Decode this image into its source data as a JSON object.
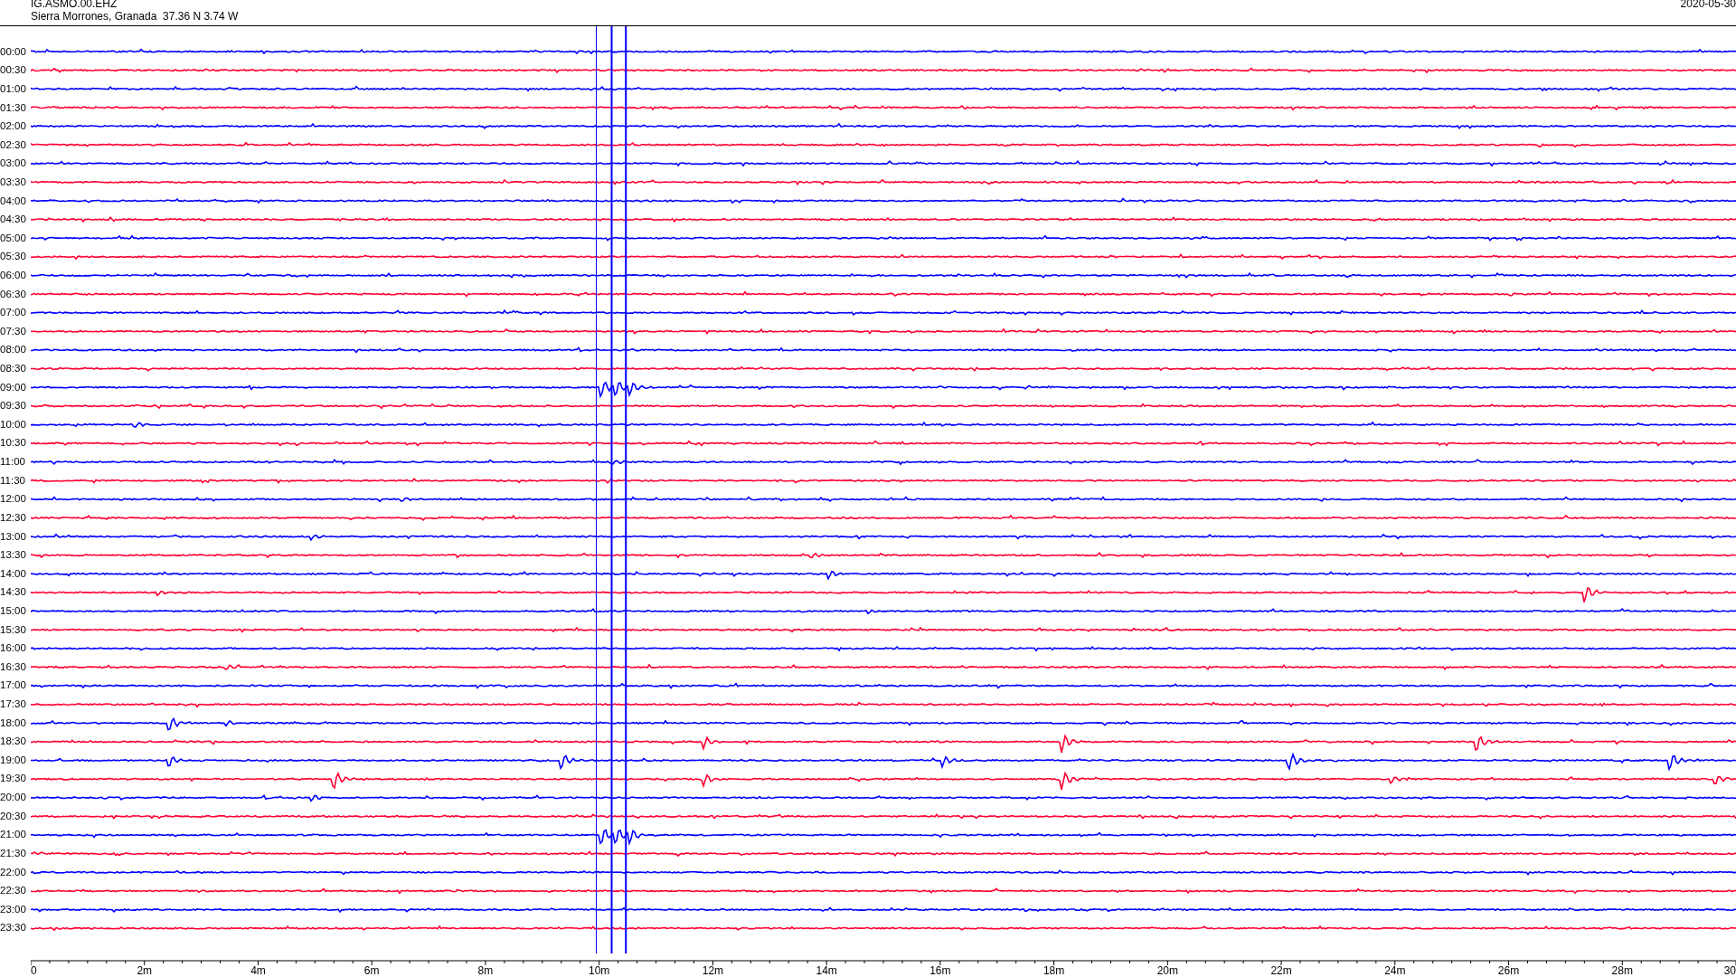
{
  "header": {
    "station": "IG.ASMO.00.EHZ",
    "location": "Sierra Morrones, Granada  37.36 N 3.74 W",
    "date": "2020-05-30"
  },
  "rows": [
    {
      "time": "00:00",
      "color": "#0000ff"
    },
    {
      "time": "00:30",
      "color": "#ff0033"
    },
    {
      "time": "01:00",
      "color": "#0000ff"
    },
    {
      "time": "01:30",
      "color": "#ff0033"
    },
    {
      "time": "02:00",
      "color": "#0000ff"
    },
    {
      "time": "02:30",
      "color": "#ff0033"
    },
    {
      "time": "03:00",
      "color": "#0000ff"
    },
    {
      "time": "03:30",
      "color": "#ff0033"
    },
    {
      "time": "04:00",
      "color": "#0000ff"
    },
    {
      "time": "04:30",
      "color": "#ff0033"
    },
    {
      "time": "05:00",
      "color": "#0000ff"
    },
    {
      "time": "05:30",
      "color": "#ff0033"
    },
    {
      "time": "06:00",
      "color": "#0000ff"
    },
    {
      "time": "06:30",
      "color": "#ff0033"
    },
    {
      "time": "07:00",
      "color": "#0000ff"
    },
    {
      "time": "07:30",
      "color": "#ff0033"
    },
    {
      "time": "08:00",
      "color": "#0000ff"
    },
    {
      "time": "08:30",
      "color": "#ff0033"
    },
    {
      "time": "09:00",
      "color": "#0000ff"
    },
    {
      "time": "09:30",
      "color": "#ff0033"
    },
    {
      "time": "10:00",
      "color": "#0000ff"
    },
    {
      "time": "10:30",
      "color": "#ff0033"
    },
    {
      "time": "11:00",
      "color": "#0000ff"
    },
    {
      "time": "11:30",
      "color": "#ff0033"
    },
    {
      "time": "12:00",
      "color": "#0000ff"
    },
    {
      "time": "12:30",
      "color": "#ff0033"
    },
    {
      "time": "13:00",
      "color": "#0000ff"
    },
    {
      "time": "13:30",
      "color": "#ff0033"
    },
    {
      "time": "14:00",
      "color": "#0000ff"
    },
    {
      "time": "14:30",
      "color": "#ff0033"
    },
    {
      "time": "15:00",
      "color": "#0000ff"
    },
    {
      "time": "15:30",
      "color": "#ff0033"
    },
    {
      "time": "16:00",
      "color": "#0000ff"
    },
    {
      "time": "16:30",
      "color": "#ff0033"
    },
    {
      "time": "17:00",
      "color": "#0000ff"
    },
    {
      "time": "17:30",
      "color": "#ff0033"
    },
    {
      "time": "18:00",
      "color": "#0000ff"
    },
    {
      "time": "18:30",
      "color": "#ff0033"
    },
    {
      "time": "19:00",
      "color": "#0000ff"
    },
    {
      "time": "19:30",
      "color": "#ff0033"
    },
    {
      "time": "20:00",
      "color": "#0000ff"
    },
    {
      "time": "20:30",
      "color": "#ff0033"
    },
    {
      "time": "21:00",
      "color": "#0000ff"
    },
    {
      "time": "21:30",
      "color": "#ff0033"
    },
    {
      "time": "22:00",
      "color": "#0000ff"
    },
    {
      "time": "22:30",
      "color": "#ff0033"
    },
    {
      "time": "23:00",
      "color": "#0000ff"
    },
    {
      "time": "23:30",
      "color": "#ff0033"
    }
  ],
  "x_axis": {
    "ticks": [
      "0",
      "2m",
      "4m",
      "6m",
      "8m",
      "10m",
      "12m",
      "14m",
      "16m",
      "18m",
      "20m",
      "22m",
      "24m",
      "26m",
      "28m",
      "30"
    ]
  }
}
